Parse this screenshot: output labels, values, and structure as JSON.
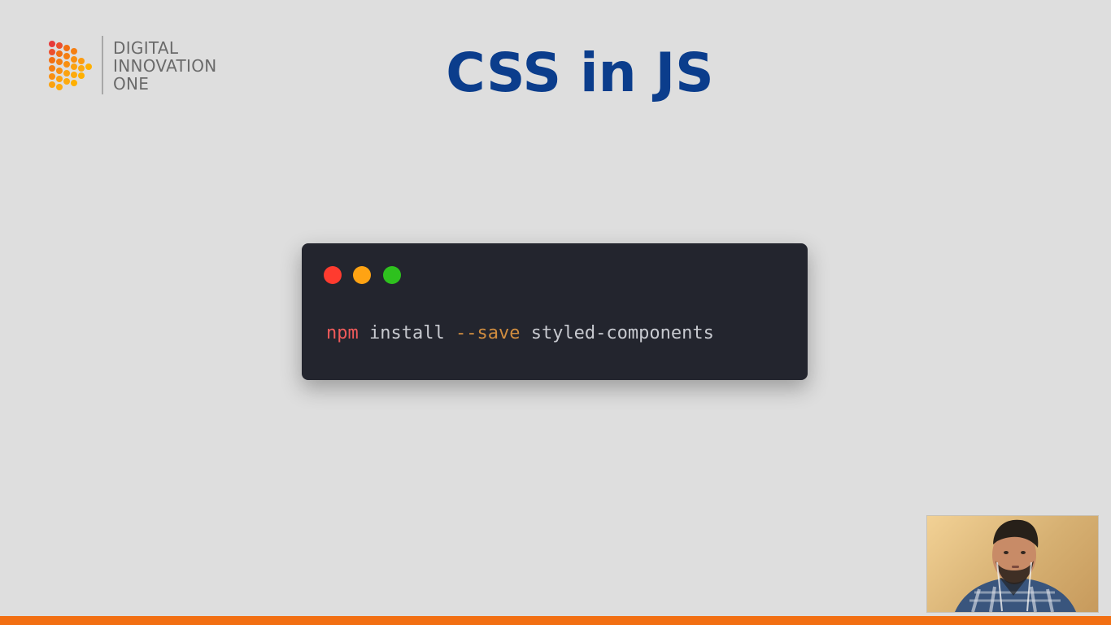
{
  "slide": {
    "title": "CSS in JS"
  },
  "brand": {
    "line1": "DIGITAL",
    "line2": "INNOVATION",
    "line3": "ONE",
    "colors": {
      "title": "#0b3d8c",
      "accent_bar": "#f26f12",
      "logo_orange": "#f26f12",
      "logo_yellow": "#ffb000",
      "logo_red": "#e63a3a"
    }
  },
  "terminal": {
    "window_controls": [
      "close-dot",
      "minimize-dot",
      "maximize-dot"
    ],
    "command": {
      "program": "npm",
      "action": "install",
      "flag": "--save",
      "package": "styled-components"
    }
  },
  "presenter": {
    "icon": "presenter-webcam"
  }
}
